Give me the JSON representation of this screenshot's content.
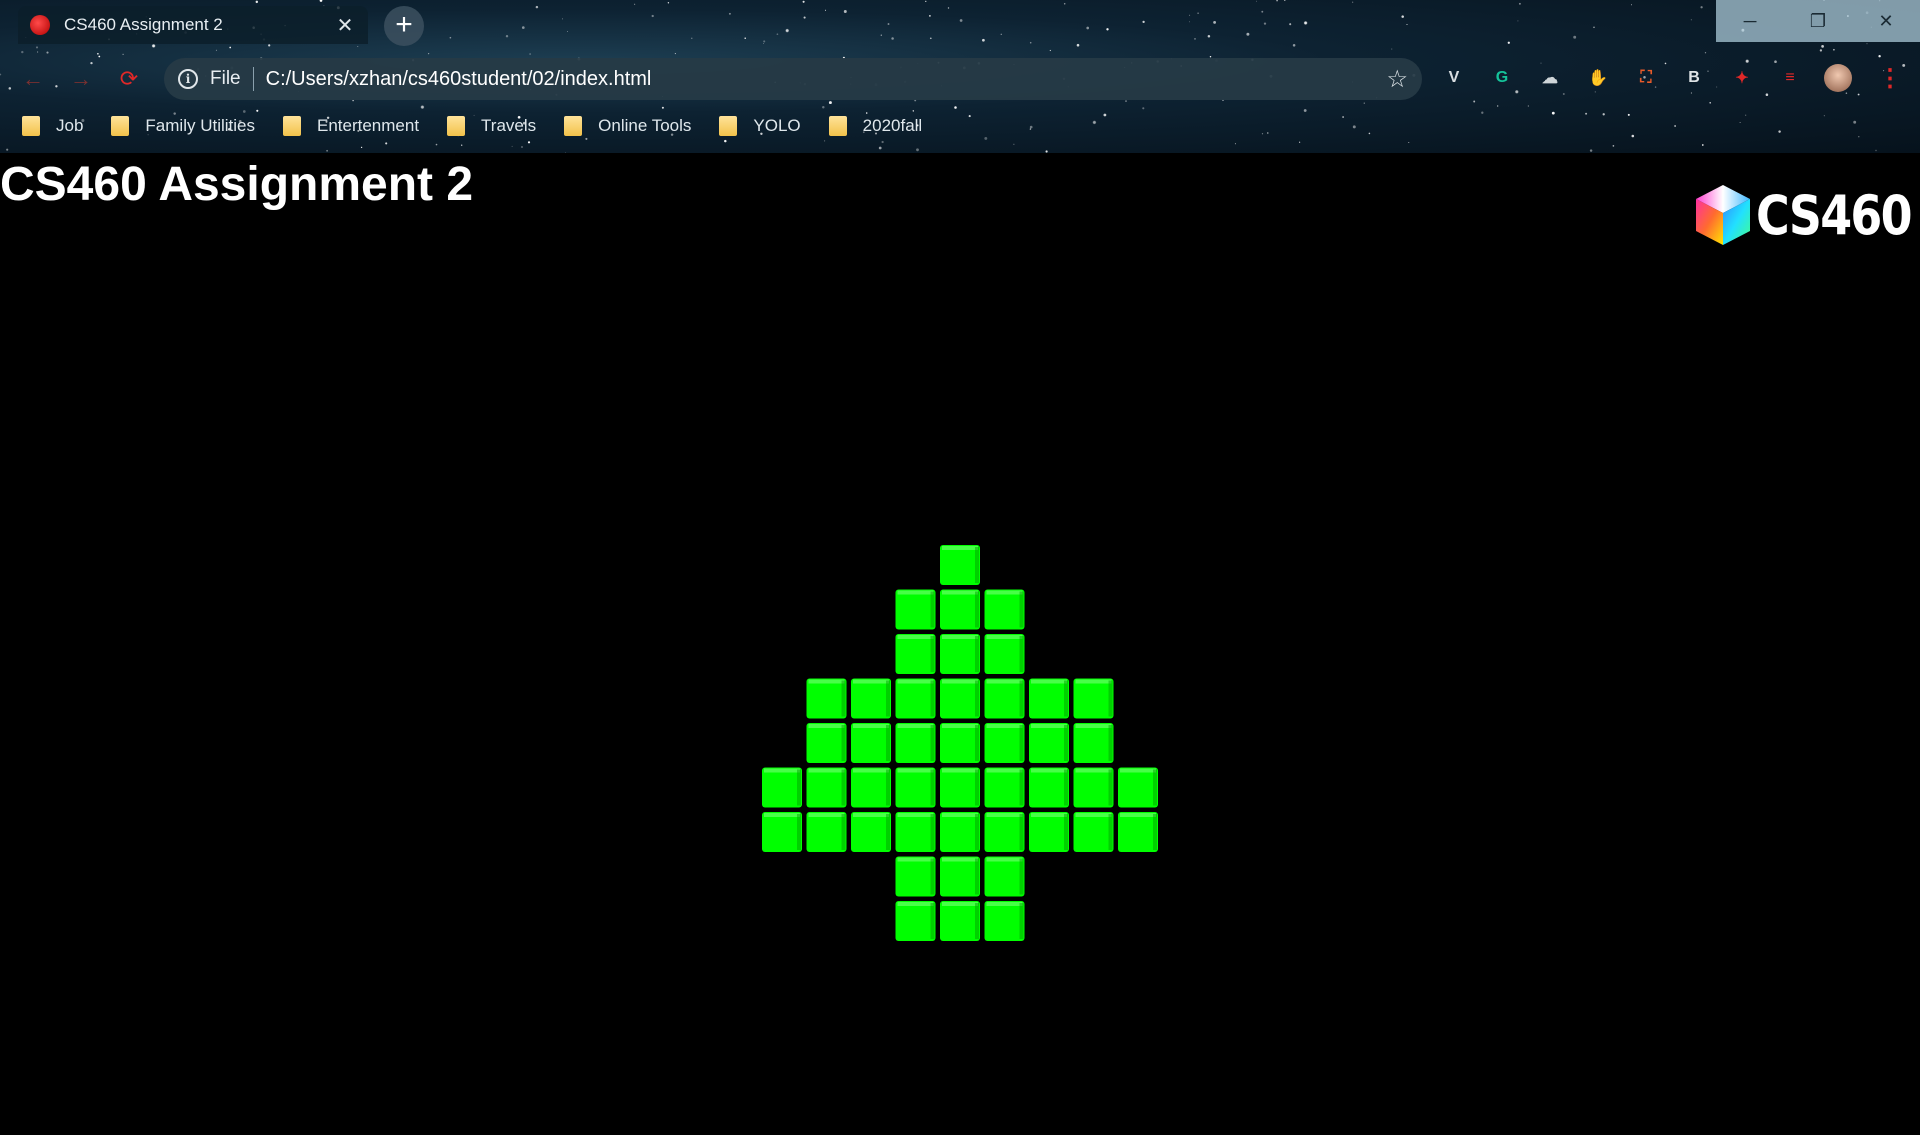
{
  "browser": {
    "tab": {
      "title": "CS460 Assignment 2",
      "close_glyph": "✕"
    },
    "new_tab_glyph": "+",
    "window_controls": {
      "minimize": "─",
      "restore": "❐",
      "close": "✕"
    },
    "nav": {
      "back": "←",
      "forward": "→",
      "reload": "⟳"
    },
    "omnibox": {
      "info_glyph": "i",
      "scheme": "File",
      "url": "C:/Users/xzhan/cs460student/02/index.html",
      "star": "☆"
    },
    "extensions": [
      {
        "name": "vivaldi-like-icon",
        "glyph": "V",
        "color": "#d8dde0"
      },
      {
        "name": "grammarly-icon",
        "glyph": "G",
        "color": "#15c39a"
      },
      {
        "name": "cloud-extension-icon",
        "glyph": "☁",
        "color": "#cfd5d8"
      },
      {
        "name": "stop-hand-icon",
        "glyph": "✋",
        "color": "#e02020"
      },
      {
        "name": "mindmap-icon",
        "glyph": "⛶",
        "color": "#e85b2a"
      },
      {
        "name": "b-extension-icon",
        "glyph": "B",
        "color": "#dfe3e6"
      },
      {
        "name": "puzzle-extension-icon",
        "glyph": "✦",
        "color": "#e02828"
      },
      {
        "name": "playlist-icon",
        "glyph": "≡",
        "color": "#e02828"
      }
    ],
    "menu_glyph": "⋮"
  },
  "bookmarks": [
    "Job",
    "Family Utilities",
    "Entertenment",
    "Travels",
    "Online Tools",
    "YOLO",
    "2020fall"
  ],
  "page": {
    "title": "CS460 Assignment 2",
    "logo_text": "CS460",
    "cube_color": "#00ff00",
    "cube_rows": [
      [
        0,
        0,
        0,
        0,
        1,
        0,
        0,
        0,
        0
      ],
      [
        0,
        0,
        0,
        1,
        1,
        1,
        0,
        0,
        0
      ],
      [
        0,
        0,
        0,
        1,
        1,
        1,
        0,
        0,
        0
      ],
      [
        0,
        1,
        1,
        1,
        1,
        1,
        1,
        1,
        0
      ],
      [
        0,
        1,
        1,
        1,
        1,
        1,
        1,
        1,
        0
      ],
      [
        1,
        1,
        1,
        1,
        1,
        1,
        1,
        1,
        1
      ],
      [
        1,
        1,
        1,
        1,
        1,
        1,
        1,
        1,
        1
      ],
      [
        0,
        0,
        0,
        1,
        1,
        1,
        0,
        0,
        0
      ],
      [
        0,
        0,
        0,
        1,
        1,
        1,
        0,
        0,
        0
      ]
    ]
  }
}
